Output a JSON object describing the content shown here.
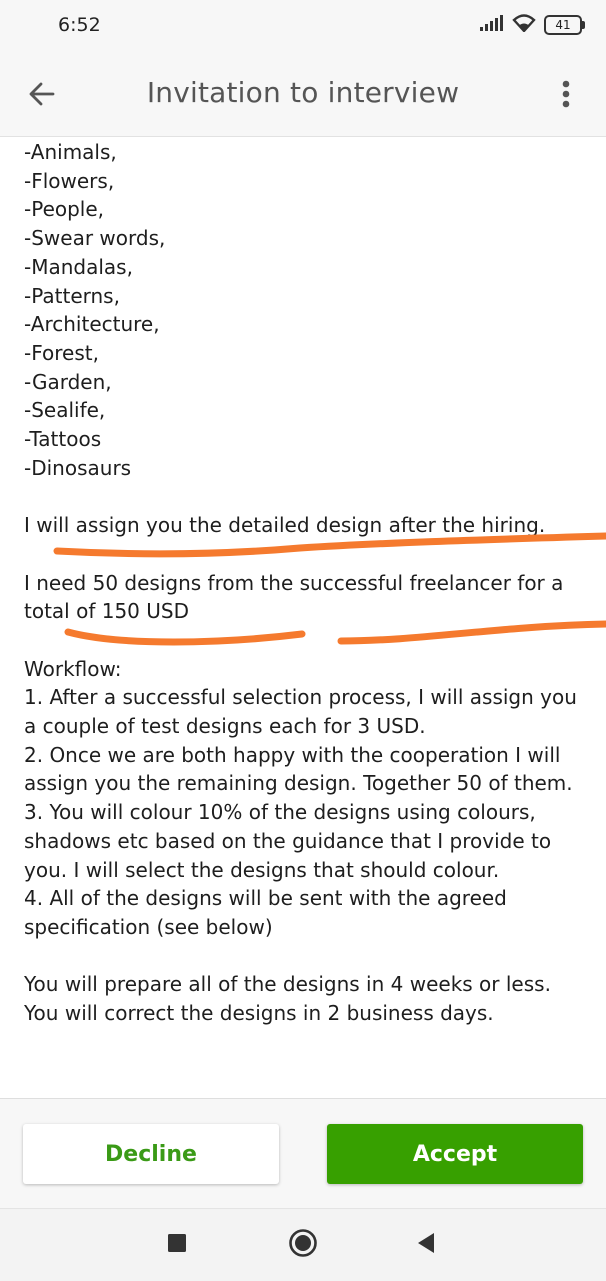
{
  "status_bar": {
    "time": "6:52",
    "battery": "41",
    "icons": [
      "signal-icon",
      "wifi-icon",
      "battery-icon"
    ]
  },
  "header": {
    "title": "Invitation to interview",
    "back_icon": "arrow-left-icon",
    "menu_icon": "more-vertical-icon"
  },
  "message": {
    "categories": [
      "-Animals,",
      "-Flowers,",
      "-People,",
      "-Swear words,",
      "-Mandalas,",
      "-Patterns,",
      "-Architecture,",
      "-Forest,",
      "-Garden,",
      "-Sealife,",
      "-Tattoos",
      "-Dinosaurs"
    ],
    "assign_line": "I will assign you the detailed design after the hiring.",
    "need_line": "I need 50 designs from the successful freelancer for a total of 150 USD",
    "workflow_title": "Workflow:",
    "workflow_steps": [
      "1. After a successful selection process, I will assign you a couple of test designs each for 3 USD.",
      "2. Once we are both happy with the cooperation I will assign you the remaining design. Together 50 of them.",
      "3. You will colour 10% of the designs using colours, shadows etc based on the guidance that I provide to you. I will select the designs that should colour.",
      "4. All of the designs will be sent with the agreed specification (see below)"
    ],
    "deadline_lines": [
      "You will prepare all of the designs in 4 weeks or less.",
      "You will correct the designs in 2 business days."
    ]
  },
  "actions": {
    "decline_label": "Decline",
    "accept_label": "Accept"
  },
  "colors": {
    "accent_green": "#37a000",
    "annotation_orange": "#f57a2e"
  },
  "nav_bar": {
    "icons": [
      "recents-square-icon",
      "home-circle-icon",
      "back-triangle-icon"
    ]
  }
}
